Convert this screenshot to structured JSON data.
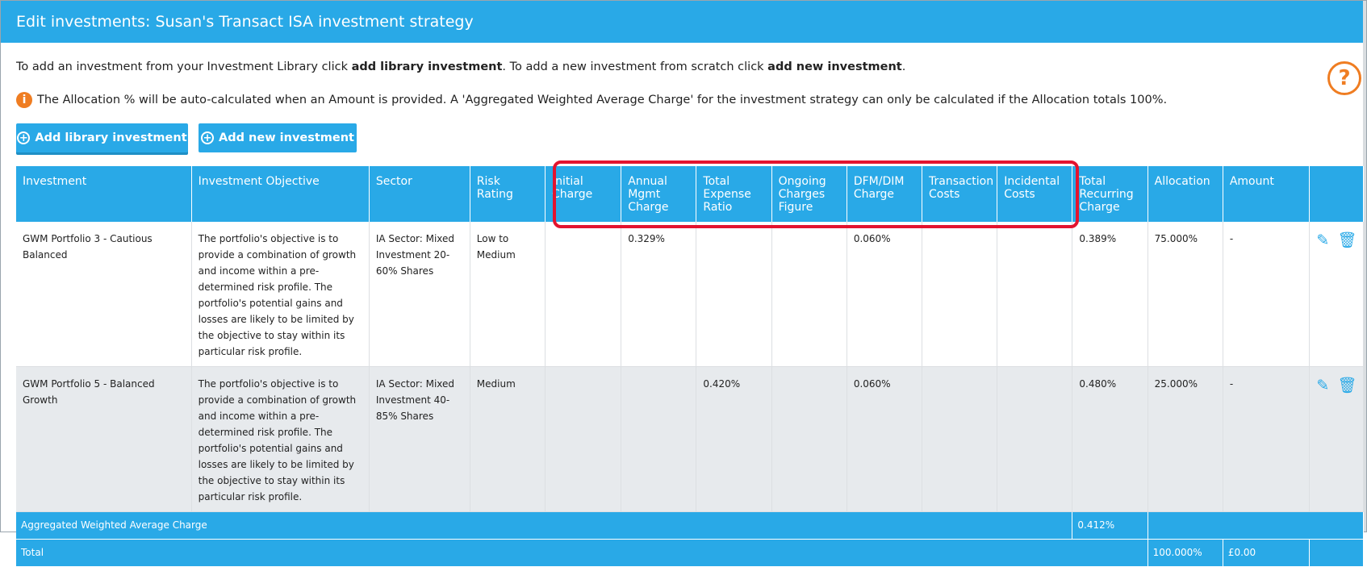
{
  "window": {
    "title": "Edit investments: Susan's Transact ISA investment strategy"
  },
  "intro": {
    "part1": "To add an investment from your Investment Library click ",
    "bold1": "add library investment",
    "part2": ". To add a new investment from scratch click ",
    "bold2": "add new investment",
    "part3": "."
  },
  "info": {
    "icon_glyph": "i",
    "text": "The Allocation % will be auto-calculated when an Amount is provided. A 'Aggregated Weighted Average Charge' for the investment strategy can only be calculated if the Allocation totals 100%."
  },
  "help": {
    "glyph": "?"
  },
  "buttons": {
    "add_library": "Add library investment",
    "add_new": "Add new investment"
  },
  "table": {
    "headers": {
      "investment": "Investment",
      "objective": "Investment Objective",
      "sector": "Sector",
      "risk": "Risk Rating",
      "initial": "Initial Charge",
      "annual": "Annual Mgmt Charge",
      "ter": "Total Expense Ratio",
      "ocf": "Ongoing Charges Figure",
      "dfm": "DFM/DIM Charge",
      "transaction": "Transaction Costs",
      "incidental": "Incidental Costs",
      "trc": "Total Recurring Charge",
      "allocation": "Allocation",
      "amount": "Amount",
      "actions": ""
    },
    "rows": [
      {
        "investment": "GWM Portfolio 3 - Cautious Balanced",
        "objective": "The portfolio's objective is to provide a combination of growth and income within a pre-determined risk profile. The portfolio's potential gains and losses are likely to be limited by the objective to stay within its particular risk profile.",
        "sector": "IA Sector: Mixed Investment 20-60% Shares",
        "risk": "Low to Medium",
        "initial": "",
        "annual": "0.329%",
        "ter": "",
        "ocf": "",
        "dfm": "0.060%",
        "transaction": "",
        "incidental": "",
        "trc": "0.389%",
        "allocation": "75.000%",
        "amount": "-"
      },
      {
        "investment": "GWM Portfolio 5 - Balanced Growth",
        "objective": "The portfolio's objective is to provide a combination of growth and income within a pre-determined risk profile. The portfolio's potential gains and losses are likely to be limited by the objective to stay within its particular risk profile.",
        "sector": "IA Sector: Mixed Investment 40-85% Shares",
        "risk": "Medium",
        "initial": "",
        "annual": "",
        "ter": "0.420%",
        "ocf": "",
        "dfm": "0.060%",
        "transaction": "",
        "incidental": "",
        "trc": "0.480%",
        "allocation": "25.000%",
        "amount": "-"
      }
    ],
    "footer": {
      "awac_label": "Aggregated Weighted Average Charge",
      "awac_value": "0.412%",
      "total_label": "Total",
      "total_allocation": "100.000%",
      "total_amount": "£0.00"
    }
  },
  "icons": {
    "edit": "pencil-icon",
    "delete": "trash-icon",
    "plus": "plus-circle-icon"
  },
  "colors": {
    "accent": "#29a9e7",
    "warning": "#ef7d22",
    "highlight": "#e3142f",
    "alt_row": "#e7eaed"
  }
}
